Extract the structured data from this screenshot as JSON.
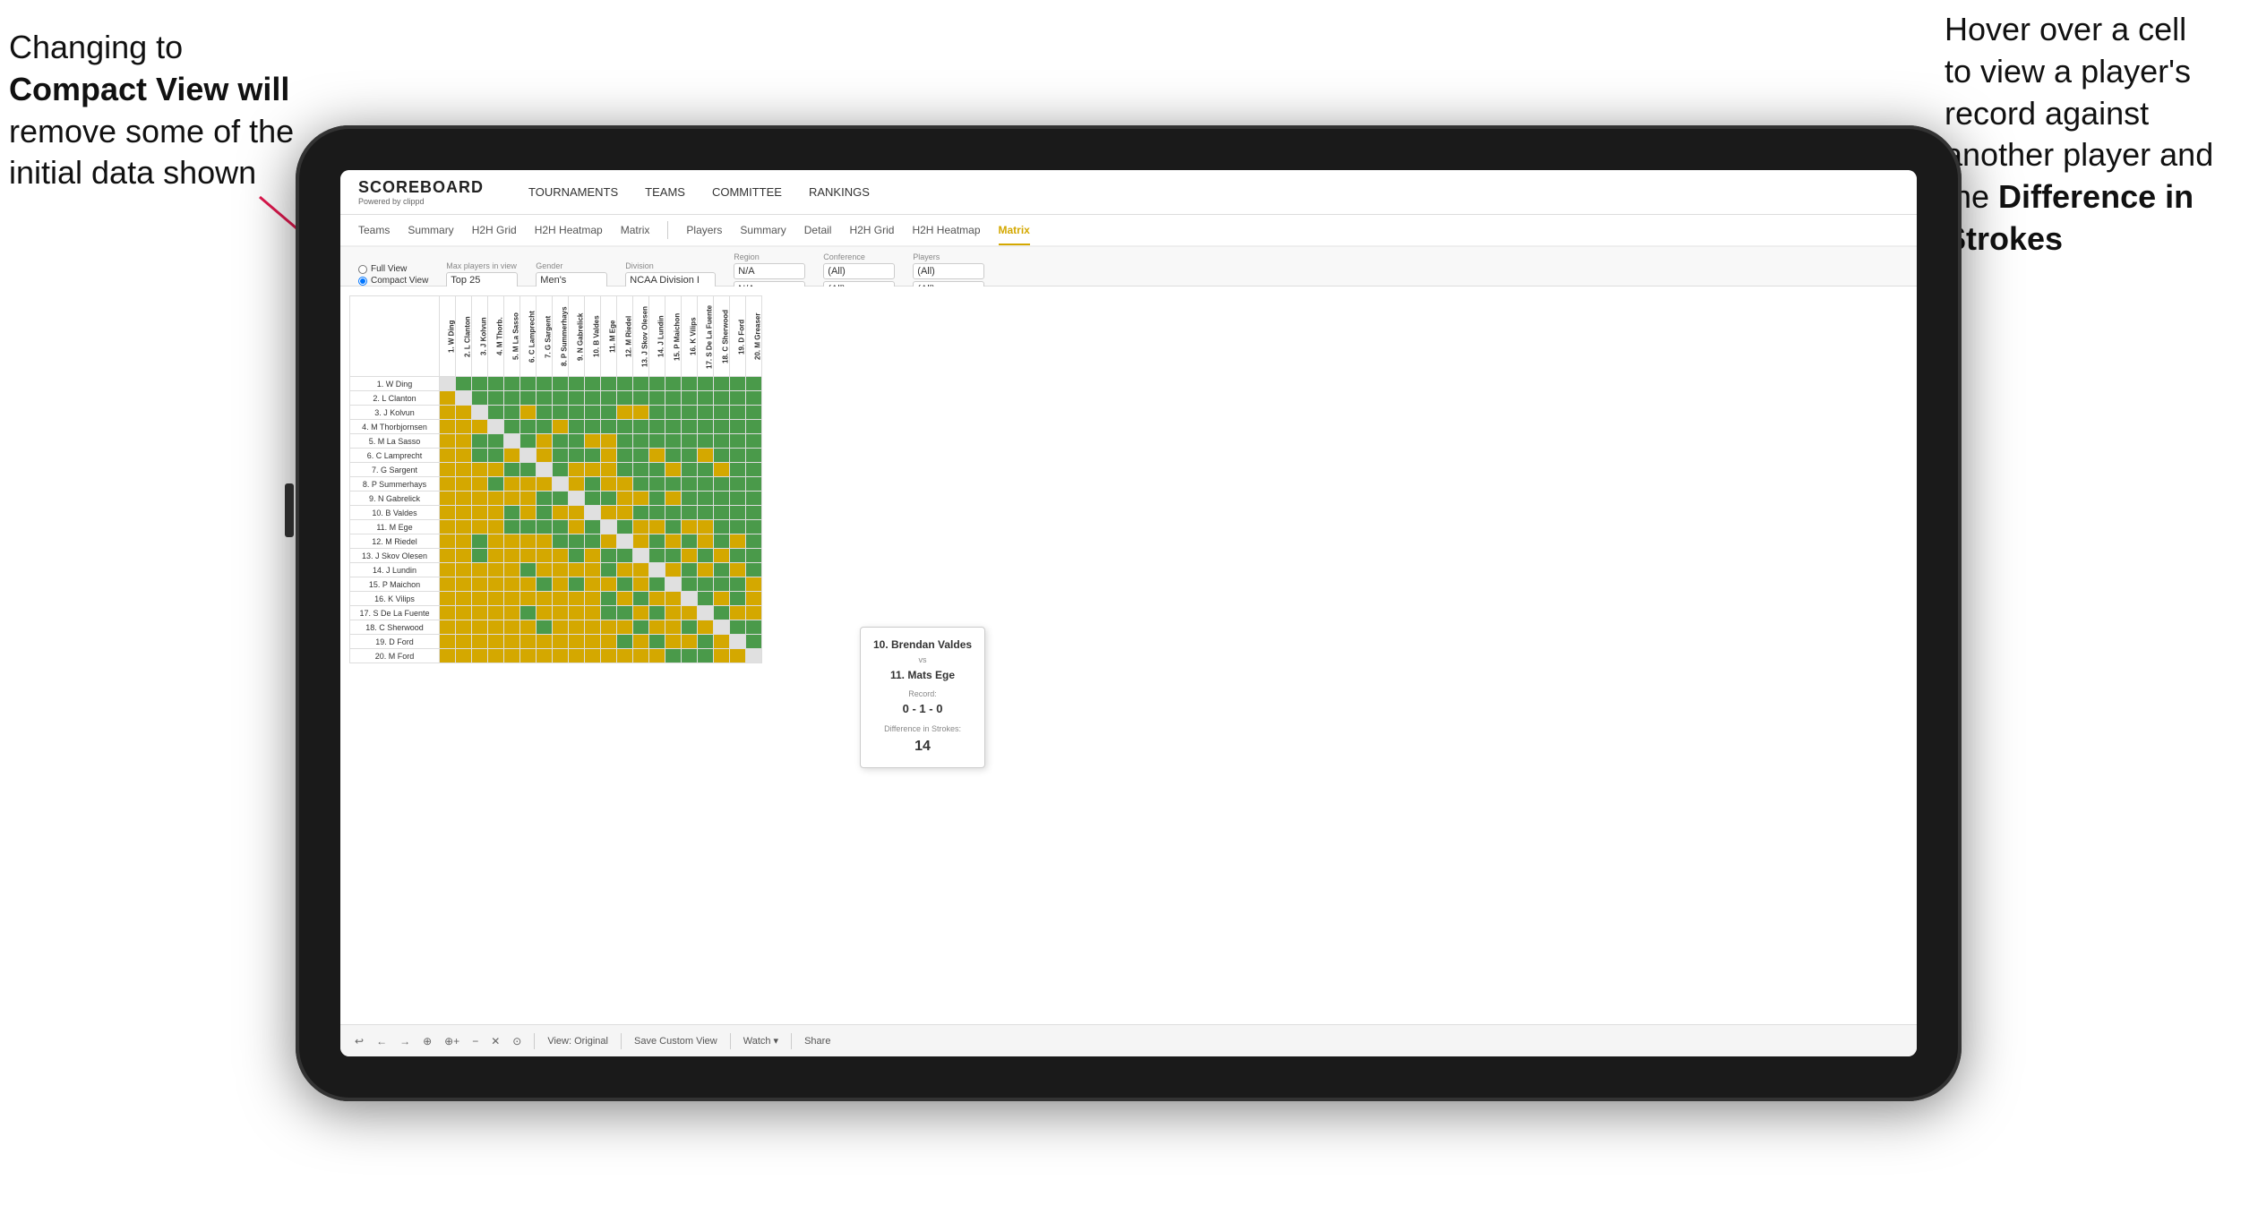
{
  "annotations": {
    "left": {
      "line1": "Changing to",
      "line2": "Compact View will",
      "line3": "remove some of the",
      "line4": "initial data shown"
    },
    "right": {
      "line1": "Hover over a cell",
      "line2": "to view a player's",
      "line3": "record against",
      "line4": "another player and",
      "line5": "the ",
      "line5bold": "Difference in",
      "line6": "Strokes"
    }
  },
  "nav": {
    "logo": "SCOREBOARD",
    "logo_sub": "Powered by clippd",
    "items": [
      "TOURNAMENTS",
      "TEAMS",
      "COMMITTEE",
      "RANKINGS"
    ]
  },
  "sub_nav": {
    "group1": [
      "Teams",
      "Summary",
      "H2H Grid",
      "H2H Heatmap",
      "Matrix"
    ],
    "group2": [
      "Players",
      "Summary",
      "Detail",
      "H2H Grid",
      "H2H Heatmap",
      "Matrix"
    ]
  },
  "filters": {
    "view_label": "",
    "full_view": "Full View",
    "compact_view": "Compact View",
    "max_players_label": "Max players in view",
    "max_players_value": "Top 25",
    "gender_label": "Gender",
    "gender_value": "Men's",
    "division_label": "Division",
    "division_value": "NCAA Division I",
    "region_label": "Region",
    "region_values": [
      "N/A",
      "N/A"
    ],
    "conference_label": "Conference",
    "conference_values": [
      "(All)",
      "(All)"
    ],
    "players_label": "Players",
    "players_values": [
      "(All)",
      "(All)"
    ]
  },
  "players": [
    "1. W Ding",
    "2. L Clanton",
    "3. J Kolvun",
    "4. M Thorbjornsen",
    "5. M La Sasso",
    "6. C Lamprecht",
    "7. G Sargent",
    "8. P Summerhays",
    "9. N Gabrelick",
    "10. B Valdes",
    "11. M Ege",
    "12. M Riedel",
    "13. J Skov Olesen",
    "14. J Lundin",
    "15. P Maichon",
    "16. K Vilips",
    "17. S De La Fuente",
    "18. C Sherwood",
    "19. D Ford",
    "20. M Ford"
  ],
  "col_headers": [
    "1. W Ding",
    "2. L Clanton",
    "3. J Kolvun",
    "4. M Thorb.",
    "5. M La Sasso",
    "6. C Lamprecht",
    "7. G Sargent",
    "8. P Summerhays",
    "9. N Gabrelick",
    "10. B Valdes",
    "11. M Ege",
    "12. M Riedel",
    "13. J Skov Olesen",
    "14. J Lundin",
    "15. P Maichon",
    "16. K Vilips",
    "17. S De La Fuente",
    "18. C Sherwood",
    "19. D Ford",
    "20. M Greaser"
  ],
  "tooltip": {
    "player1": "10. Brendan Valdes",
    "vs": "vs",
    "player2": "11. Mats Ege",
    "record_label": "Record:",
    "record": "0 - 1 - 0",
    "diff_label": "Difference in Strokes:",
    "diff": "14"
  },
  "toolbar": {
    "buttons": [
      "↩",
      "←",
      "→",
      "⊕",
      "⊕+",
      "−",
      "✕",
      "⊙"
    ],
    "view_original": "View: Original",
    "save_custom": "Save Custom View",
    "watch": "Watch ▾",
    "share": "Share"
  }
}
